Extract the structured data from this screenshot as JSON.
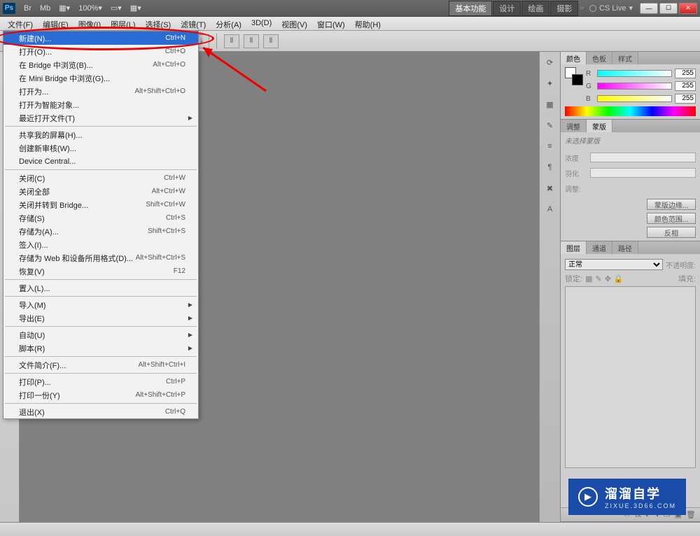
{
  "titlebar": {
    "app": "Ps",
    "br": "Br",
    "mb": "Mb",
    "zoom": "100%",
    "workspace": [
      "基本功能",
      "设计",
      "绘画",
      "摄影"
    ],
    "cslive": "CS Live"
  },
  "menubar": [
    "文件(F)",
    "编辑(E)",
    "图像(I)",
    "图层(L)",
    "选择(S)",
    "滤镜(T)",
    "分析(A)",
    "3D(D)",
    "视图(V)",
    "窗口(W)",
    "帮助(H)"
  ],
  "file_menu": {
    "g1": [
      {
        "label": "新建(N)...",
        "sc": "Ctrl+N",
        "hi": true
      },
      {
        "label": "打开(O)...",
        "sc": "Ctrl+O"
      },
      {
        "label": "在 Bridge 中浏览(B)...",
        "sc": "Alt+Ctrl+O"
      },
      {
        "label": "在 Mini Bridge 中浏览(G)..."
      },
      {
        "label": "打开为...",
        "sc": "Alt+Shift+Ctrl+O"
      },
      {
        "label": "打开为智能对象..."
      },
      {
        "label": "最近打开文件(T)",
        "sub": true
      }
    ],
    "g2": [
      {
        "label": "共享我的屏幕(H)..."
      },
      {
        "label": "创建新审核(W)..."
      },
      {
        "label": "Device Central..."
      }
    ],
    "g3": [
      {
        "label": "关闭(C)",
        "sc": "Ctrl+W"
      },
      {
        "label": "关闭全部",
        "sc": "Alt+Ctrl+W"
      },
      {
        "label": "关闭并转到 Bridge...",
        "sc": "Shift+Ctrl+W"
      },
      {
        "label": "存储(S)",
        "sc": "Ctrl+S"
      },
      {
        "label": "存储为(A)...",
        "sc": "Shift+Ctrl+S"
      },
      {
        "label": "签入(I)..."
      },
      {
        "label": "存储为 Web 和设备所用格式(D)...",
        "sc": "Alt+Shift+Ctrl+S"
      },
      {
        "label": "恢复(V)",
        "sc": "F12"
      }
    ],
    "g4": [
      {
        "label": "置入(L)..."
      }
    ],
    "g5": [
      {
        "label": "导入(M)",
        "sub": true
      },
      {
        "label": "导出(E)",
        "sub": true
      }
    ],
    "g6": [
      {
        "label": "自动(U)",
        "sub": true
      },
      {
        "label": "脚本(R)",
        "sub": true
      }
    ],
    "g7": [
      {
        "label": "文件简介(F)...",
        "sc": "Alt+Shift+Ctrl+I"
      }
    ],
    "g8": [
      {
        "label": "打印(P)...",
        "sc": "Ctrl+P"
      },
      {
        "label": "打印一份(Y)",
        "sc": "Alt+Shift+Ctrl+P"
      }
    ],
    "g9": [
      {
        "label": "退出(X)",
        "sc": "Ctrl+Q"
      }
    ]
  },
  "color_panel": {
    "tabs": [
      "颜色",
      "色板",
      "样式"
    ],
    "r": "255",
    "g": "255",
    "b": "255",
    "r_label": "R",
    "g_label": "G",
    "b_label": "B"
  },
  "mask_panel": {
    "tabs": [
      "调整",
      "蒙版"
    ],
    "msg": "未选择蒙版",
    "density": "浓度",
    "feather": "羽化",
    "refine": "调整:",
    "btn_edge": "蒙版边缘...",
    "btn_range": "颜色范围...",
    "btn_invert": "反相"
  },
  "layer_panel": {
    "tabs": [
      "图层",
      "通道",
      "路径"
    ],
    "blend": "正常",
    "opacity_label": "不透明度:",
    "lock_label": "锁定:",
    "fill_label": "填充:"
  },
  "watermark": {
    "line1": "溜溜自学",
    "line2": "ZIXUE.3D66.COM"
  }
}
